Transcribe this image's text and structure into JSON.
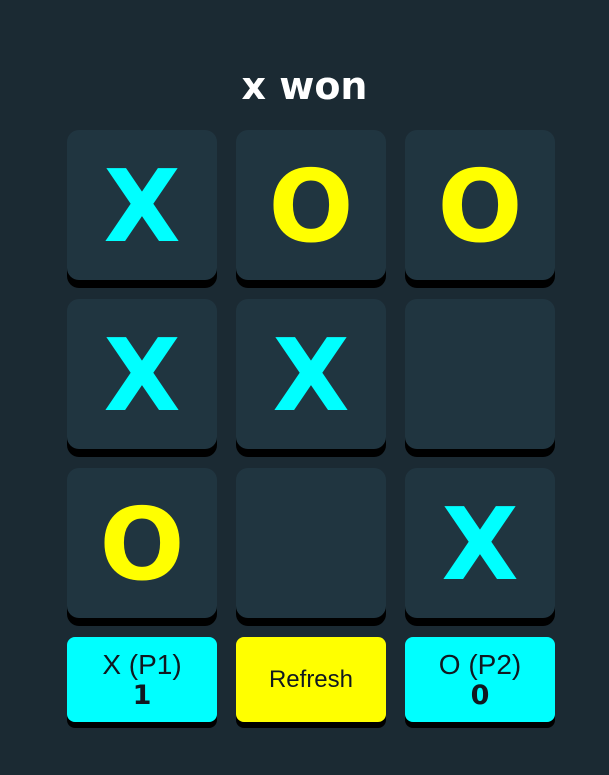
{
  "status": "x won",
  "colors": {
    "background": "#1b2a33",
    "cell": "#203540",
    "x": "#00ffff",
    "o": "#ffff00"
  },
  "board": [
    [
      "X",
      "O",
      "O"
    ],
    [
      "X",
      "X",
      ""
    ],
    [
      "O",
      "",
      "X"
    ]
  ],
  "scores": {
    "x_label": "X (P1)",
    "x_value": "1",
    "refresh_label": "Refresh",
    "o_label": "O (P2)",
    "o_value": "0"
  }
}
